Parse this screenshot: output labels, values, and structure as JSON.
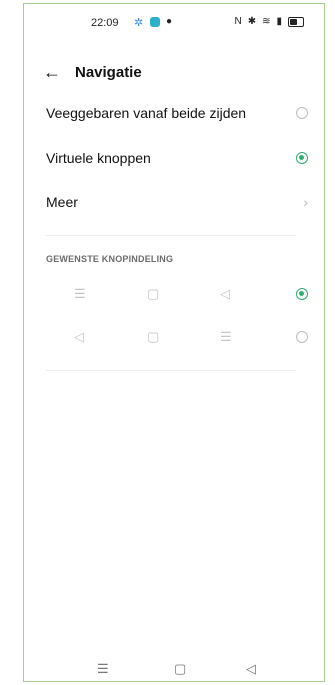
{
  "status_bar": {
    "time": "22:09",
    "icons": [
      "gear-icon",
      "app-icon",
      "location-icon",
      "nfc-icon",
      "bluetooth-icon",
      "wifi-icon",
      "signal-icon",
      "battery-icon"
    ]
  },
  "header": {
    "back_glyph": "←",
    "title": "Navigatie"
  },
  "options": [
    {
      "label": "Veeggebaren vanaf beide zijden",
      "selected": false
    },
    {
      "label": "Virtuele knoppen",
      "selected": true
    }
  ],
  "more": {
    "label": "Meer",
    "chevron": "›"
  },
  "layout_section": {
    "title": "GEWENSTE KNOPINDELING",
    "layouts": [
      {
        "buttons": [
          "☰",
          "▢",
          "◁"
        ],
        "selected": true
      },
      {
        "buttons": [
          "◁",
          "▢",
          "☰"
        ],
        "selected": false
      }
    ]
  },
  "system_nav": {
    "menu": "☰",
    "home": "▢",
    "back": "◁"
  },
  "colors": {
    "accent": "#2eaf6f",
    "frame": "#a8d08d"
  }
}
